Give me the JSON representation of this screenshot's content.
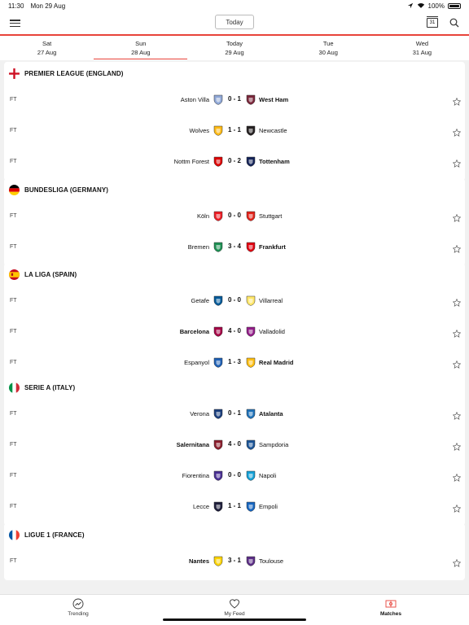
{
  "status_bar": {
    "time": "11:30",
    "date": "Mon 29 Aug",
    "battery": "100%"
  },
  "header": {
    "today_label": "Today",
    "calendar_day": "31"
  },
  "day_tabs": [
    {
      "day": "Sat",
      "date": "27 Aug",
      "active": false
    },
    {
      "day": "Sun",
      "date": "28 Aug",
      "active": true
    },
    {
      "day": "Today",
      "date": "29 Aug",
      "active": false
    },
    {
      "day": "Tue",
      "date": "30 Aug",
      "active": false
    },
    {
      "day": "Wed",
      "date": "31 Aug",
      "active": false
    }
  ],
  "leagues": [
    {
      "title": "PREMIER LEAGUE (ENGLAND)",
      "flag": "england",
      "matches": [
        {
          "status": "FT",
          "home": "Aston Villa",
          "away": "West Ham",
          "score": "0 - 1",
          "home_bold": false,
          "away_bold": true,
          "home_color": "#8ea6d6",
          "away_color": "#7a263a"
        },
        {
          "status": "FT",
          "home": "Wolves",
          "away": "Newcastle",
          "score": "1 - 1",
          "home_bold": false,
          "away_bold": false,
          "home_color": "#fdb913",
          "away_color": "#241f20"
        },
        {
          "status": "FT",
          "home": "Nottm Forest",
          "away": "Tottenham",
          "score": "0 - 2",
          "home_bold": false,
          "away_bold": true,
          "home_color": "#dd0000",
          "away_color": "#132257"
        }
      ]
    },
    {
      "title": "BUNDESLIGA (GERMANY)",
      "flag": "germany",
      "matches": [
        {
          "status": "FT",
          "home": "Köln",
          "away": "Stuttgart",
          "score": "0 - 0",
          "home_bold": false,
          "away_bold": false,
          "home_color": "#ed1c24",
          "away_color": "#e32219"
        },
        {
          "status": "FT",
          "home": "Bremen",
          "away": "Frankfurt",
          "score": "3 - 4",
          "home_bold": false,
          "away_bold": true,
          "home_color": "#1d9053",
          "away_color": "#e1000f"
        }
      ]
    },
    {
      "title": "LA LIGA (SPAIN)",
      "flag": "spain",
      "matches": [
        {
          "status": "FT",
          "home": "Getafe",
          "away": "Villarreal",
          "score": "0 - 0",
          "home_bold": false,
          "away_bold": false,
          "home_color": "#005999",
          "away_color": "#ffe667"
        },
        {
          "status": "FT",
          "home": "Barcelona",
          "away": "Valladolid",
          "score": "4 - 0",
          "home_bold": true,
          "away_bold": false,
          "home_color": "#a50044",
          "away_color": "#921b88"
        },
        {
          "status": "FT",
          "home": "Espanyol",
          "away": "Real Madrid",
          "score": "1 - 3",
          "home_bold": false,
          "away_bold": true,
          "home_color": "#1e60b5",
          "away_color": "#febe10"
        }
      ]
    },
    {
      "title": "SERIE A (ITALY)",
      "flag": "italy",
      "matches": [
        {
          "status": "FT",
          "home": "Verona",
          "away": "Atalanta",
          "score": "0 - 1",
          "home_bold": false,
          "away_bold": true,
          "home_color": "#1a3e7d",
          "away_color": "#1e71b8"
        },
        {
          "status": "FT",
          "home": "Salernitana",
          "away": "Sampdoria",
          "score": "4 - 0",
          "home_bold": true,
          "away_bold": false,
          "home_color": "#8b1d2c",
          "away_color": "#1b5497"
        },
        {
          "status": "FT",
          "home": "Fiorentina",
          "away": "Napoli",
          "score": "0 - 0",
          "home_bold": false,
          "away_bold": false,
          "home_color": "#482e92",
          "away_color": "#12a0d7"
        },
        {
          "status": "FT",
          "home": "Lecce",
          "away": "Empoli",
          "score": "1 - 1",
          "home_bold": false,
          "away_bold": false,
          "home_color": "#1d1d3a",
          "away_color": "#1565c0"
        }
      ]
    },
    {
      "title": "LIGUE 1 (FRANCE)",
      "flag": "france",
      "matches": [
        {
          "status": "FT",
          "home": "Nantes",
          "away": "Toulouse",
          "score": "3 - 1",
          "home_bold": true,
          "away_bold": false,
          "home_color": "#fcd405",
          "away_color": "#5b2d86"
        }
      ]
    }
  ],
  "tabbar": [
    {
      "label": "Trending",
      "icon": "trending-icon",
      "active": false
    },
    {
      "label": "My Feed",
      "icon": "heart-icon",
      "active": false
    },
    {
      "label": "Matches",
      "icon": "pitch-icon",
      "active": true
    }
  ],
  "colors": {
    "accent": "#e8433a"
  }
}
